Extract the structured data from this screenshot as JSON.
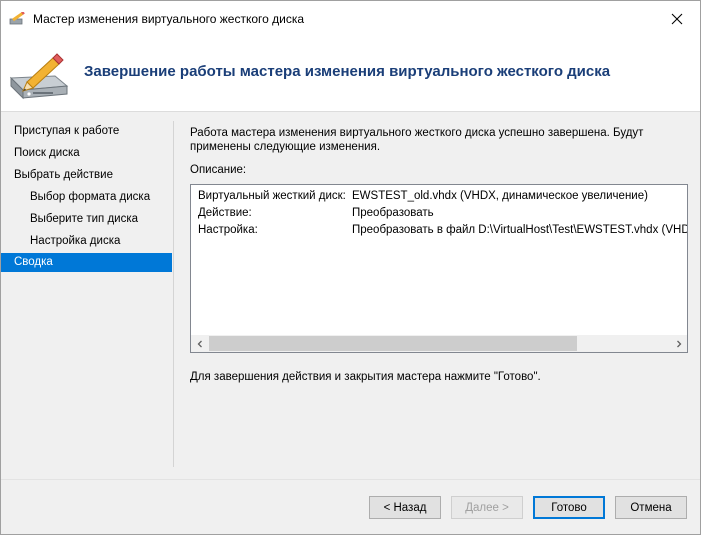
{
  "window": {
    "title": "Мастер изменения виртуального жесткого диска"
  },
  "header": {
    "title": "Завершение работы мастера изменения виртуального жесткого диска"
  },
  "nav": {
    "items": [
      {
        "label": "Приступая к работе",
        "level": 0,
        "selected": false
      },
      {
        "label": "Поиск диска",
        "level": 0,
        "selected": false
      },
      {
        "label": "Выбрать действие",
        "level": 0,
        "selected": false
      },
      {
        "label": "Выбор формата диска",
        "level": 1,
        "selected": false
      },
      {
        "label": "Выберите тип диска",
        "level": 1,
        "selected": false
      },
      {
        "label": "Настройка диска",
        "level": 1,
        "selected": false
      },
      {
        "label": "Сводка",
        "level": 0,
        "selected": true
      }
    ]
  },
  "main": {
    "message": "Работа мастера изменения виртуального жесткого диска успешно завершена. Будут применены следующие изменения.",
    "description_label": "Описание:",
    "summary": [
      {
        "key": "Виртуальный жесткий диск:",
        "value": "EWSTEST_old.vhdx (VHDX, динамическое увеличение)"
      },
      {
        "key": "Действие:",
        "value": "Преобразовать"
      },
      {
        "key": "Настройка:",
        "value": "Преобразовать в файл D:\\VirtualHost\\Test\\EWSTEST.vhdx (VHDX, ф"
      }
    ],
    "finish_hint": "Для завершения действия и закрытия мастера нажмите \"Готово\"."
  },
  "buttons": {
    "back": "< Назад",
    "next": "Далее >",
    "finish": "Готово",
    "cancel": "Отмена"
  },
  "colors": {
    "accent": "#0078d7",
    "heading": "#1a3e78"
  },
  "icons": {
    "app": "wizard-pencil-icon",
    "close": "close-icon",
    "header": "disk-pencil-icon"
  }
}
